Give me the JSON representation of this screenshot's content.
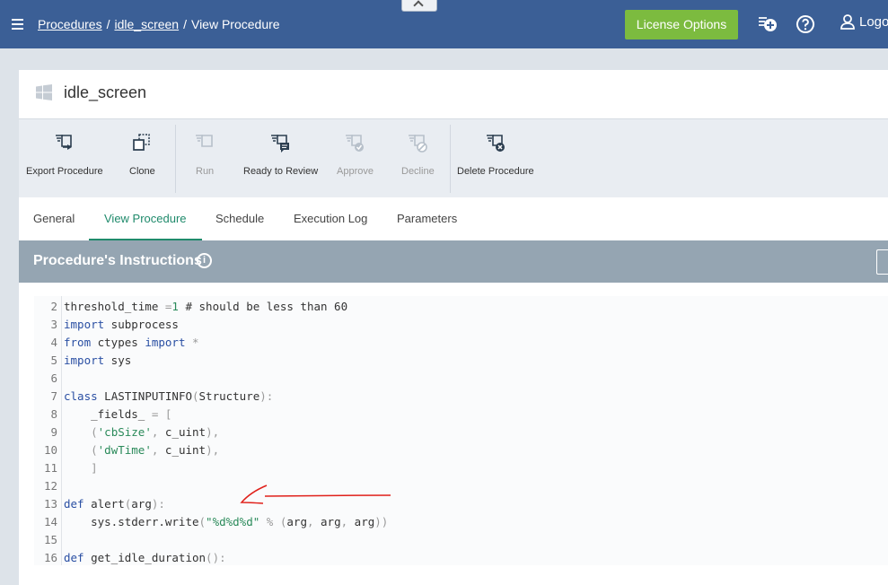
{
  "breadcrumb": {
    "items": [
      "Procedures",
      "idle_screen"
    ],
    "current": "View Procedure",
    "separator": "/"
  },
  "header": {
    "license_label": "License Options",
    "logout_label": "Logo",
    "icons": [
      "add-procedure-icon",
      "help-icon",
      "user-icon"
    ]
  },
  "procedure": {
    "title": "idle_screen"
  },
  "toolbar": {
    "items": [
      {
        "label": "Export Procedure",
        "icon": "export-icon",
        "enabled": true
      },
      {
        "label": "Clone",
        "icon": "clone-icon",
        "enabled": true
      },
      {
        "label": "Run",
        "icon": "run-icon",
        "enabled": false
      },
      {
        "label": "Ready to Review",
        "icon": "review-icon",
        "enabled": true
      },
      {
        "label": "Approve",
        "icon": "approve-icon",
        "enabled": false
      },
      {
        "label": "Decline",
        "icon": "decline-icon",
        "enabled": false
      },
      {
        "label": "Delete Procedure",
        "icon": "delete-icon",
        "enabled": true
      }
    ]
  },
  "tabs": {
    "items": [
      "General",
      "View Procedure",
      "Schedule",
      "Execution Log",
      "Parameters"
    ],
    "active": "View Procedure"
  },
  "instructions": {
    "title": "Procedure's Instructions",
    "info_glyph": "i"
  },
  "code": {
    "lines": [
      {
        "n": "2",
        "text": "threshold_time =1 # should be less than 60"
      },
      {
        "n": "3",
        "text": "import subprocess"
      },
      {
        "n": "4",
        "text": "from ctypes import *"
      },
      {
        "n": "5",
        "text": "import sys"
      },
      {
        "n": "6",
        "text": ""
      },
      {
        "n": "7",
        "text": "class LASTINPUTINFO(Structure):"
      },
      {
        "n": "8",
        "text": "    _fields_ = ["
      },
      {
        "n": "9",
        "text": "    ('cbSize', c_uint),"
      },
      {
        "n": "10",
        "text": "    ('dwTime', c_uint),"
      },
      {
        "n": "11",
        "text": "    ]"
      },
      {
        "n": "12",
        "text": ""
      },
      {
        "n": "13",
        "text": "def alert(arg):"
      },
      {
        "n": "14",
        "text": "    sys.stderr.write(\"%d%d%d\" % (arg, arg, arg))"
      },
      {
        "n": "15",
        "text": ""
      },
      {
        "n": "16",
        "text": "def get_idle_duration():"
      }
    ]
  },
  "colors": {
    "topbar": "#3b5f96",
    "license_button": "#7cbb3f",
    "active_tab": "#1f8a6b",
    "instructions_bar": "#95a5b2",
    "annotation_arrow": "#e0201a"
  }
}
